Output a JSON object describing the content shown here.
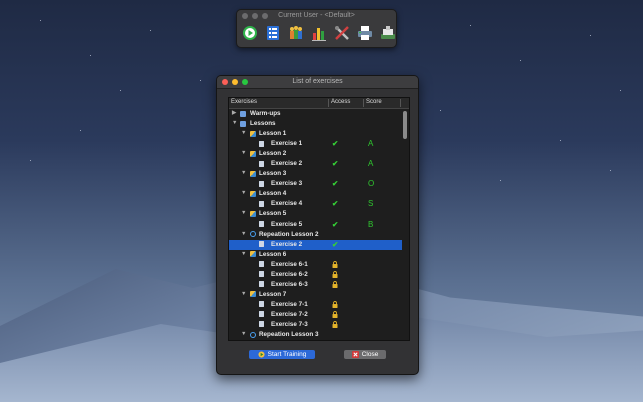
{
  "toolbar_window": {
    "title": "Current User - <Default>",
    "tools": [
      "play-icon",
      "list-icon",
      "people-icon",
      "bar-chart-icon",
      "tools-icon",
      "printer-icon",
      "stamp-icon"
    ]
  },
  "main_window": {
    "title": "List of exercises",
    "columns": {
      "exercises": "Exercises",
      "access": "Access",
      "score": "Score"
    },
    "rows": [
      {
        "level": 0,
        "expander": "▶",
        "icon": "folder",
        "label": "Warm-ups",
        "access": "",
        "score": ""
      },
      {
        "level": 0,
        "expander": "▼",
        "icon": "folder",
        "label": "Lessons",
        "access": "",
        "score": ""
      },
      {
        "level": 1,
        "expander": "▼",
        "icon": "lesson",
        "label": "Lesson 1",
        "access": "",
        "score": ""
      },
      {
        "level": 2,
        "expander": "",
        "icon": "doc",
        "label": "Exercise 1",
        "access": "check",
        "score": "A"
      },
      {
        "level": 1,
        "expander": "▼",
        "icon": "lesson",
        "label": "Lesson 2",
        "access": "",
        "score": ""
      },
      {
        "level": 2,
        "expander": "",
        "icon": "doc",
        "label": "Exercise 2",
        "access": "check",
        "score": "A"
      },
      {
        "level": 1,
        "expander": "▼",
        "icon": "lesson",
        "label": "Lesson 3",
        "access": "",
        "score": ""
      },
      {
        "level": 2,
        "expander": "",
        "icon": "doc",
        "label": "Exercise 3",
        "access": "check",
        "score": "O"
      },
      {
        "level": 1,
        "expander": "▼",
        "icon": "lesson",
        "label": "Lesson 4",
        "access": "",
        "score": ""
      },
      {
        "level": 2,
        "expander": "",
        "icon": "doc",
        "label": "Exercise 4",
        "access": "check",
        "score": "S"
      },
      {
        "level": 1,
        "expander": "▼",
        "icon": "lesson",
        "label": "Lesson 5",
        "access": "",
        "score": ""
      },
      {
        "level": 2,
        "expander": "",
        "icon": "doc",
        "label": "Exercise 5",
        "access": "check",
        "score": "B"
      },
      {
        "level": 1,
        "expander": "▼",
        "icon": "repeat",
        "label": "Repeation Lesson 2",
        "access": "",
        "score": ""
      },
      {
        "level": 2,
        "expander": "",
        "icon": "doc",
        "label": "Exercise 2",
        "access": "check",
        "score": "",
        "selected": true
      },
      {
        "level": 1,
        "expander": "▼",
        "icon": "lesson",
        "label": "Lesson 6",
        "access": "",
        "score": ""
      },
      {
        "level": 2,
        "expander": "",
        "icon": "doc",
        "label": "Exercise 6-1",
        "access": "lock",
        "score": ""
      },
      {
        "level": 2,
        "expander": "",
        "icon": "doc",
        "label": "Exercise 6-2",
        "access": "lock",
        "score": ""
      },
      {
        "level": 2,
        "expander": "",
        "icon": "doc",
        "label": "Exercise 6-3",
        "access": "lock",
        "score": ""
      },
      {
        "level": 1,
        "expander": "▼",
        "icon": "lesson",
        "label": "Lesson 7",
        "access": "",
        "score": ""
      },
      {
        "level": 2,
        "expander": "",
        "icon": "doc",
        "label": "Exercise 7-1",
        "access": "lock",
        "score": ""
      },
      {
        "level": 2,
        "expander": "",
        "icon": "doc",
        "label": "Exercise 7-2",
        "access": "lock",
        "score": ""
      },
      {
        "level": 2,
        "expander": "",
        "icon": "doc",
        "label": "Exercise 7-3",
        "access": "lock",
        "score": ""
      },
      {
        "level": 1,
        "expander": "▼",
        "icon": "repeat",
        "label": "Repeation Lesson 3",
        "access": "",
        "score": ""
      }
    ],
    "buttons": {
      "start": "Start Training",
      "close": "Close"
    }
  },
  "colors": {
    "selection": "#1f5fc9",
    "check": "#35d035",
    "score": "#2fc72f",
    "lock": "#e2b22a",
    "start_button": "#2c69d8"
  }
}
